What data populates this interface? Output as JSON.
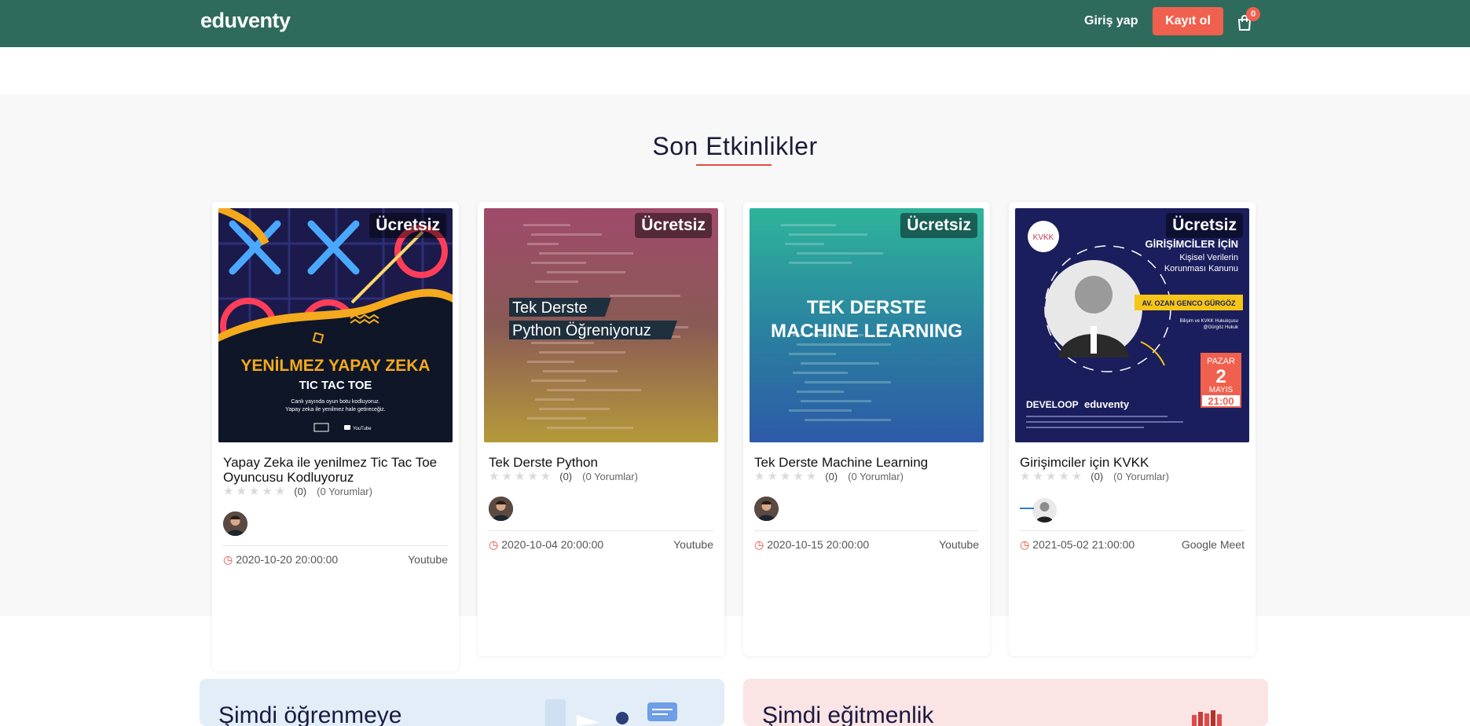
{
  "header": {
    "logo": "eduventy",
    "login_label": "Giriş yap",
    "register_label": "Kayıt ol",
    "cart_count": "0",
    "colors": {
      "bar": "#2f6b5c",
      "accent": "#f0604e"
    }
  },
  "events": {
    "title": "Son Etkinlikler",
    "cards": [
      {
        "badge": "Ücretsiz",
        "title": "Yapay Zeka ile yenilmez Tic Tac Toe Oyuncusu Kodluyoruz",
        "stars": "★★★★★",
        "rating_count": "(0)",
        "reviews": "(0 Yorumlar)",
        "date": "2020-10-20 20:00:00",
        "platform": "Youtube",
        "poster": {
          "headline": "YENİLMEZ YAPAY ZEKA",
          "sub": "TIC TAC TOE",
          "line1": "Canlı yayında oyun botu kodluyoruz.",
          "line2": "Yapay zeka ile yenilmez hale getireceğiz.",
          "yt": "YouTube"
        }
      },
      {
        "badge": "Ücretsiz",
        "title": "Tek Derste Python",
        "stars": "★★★★★",
        "rating_count": "(0)",
        "reviews": "(0 Yorumlar)",
        "date": "2020-10-04 20:00:00",
        "platform": "Youtube",
        "poster": {
          "line1": "Tek Derste",
          "line2": "Python Öğreniyoruz"
        }
      },
      {
        "badge": "Ücretsiz",
        "title": "Tek Derste Machine Learning",
        "stars": "★★★★★",
        "rating_count": "(0)",
        "reviews": "(0 Yorumlar)",
        "date": "2020-10-15 20:00:00",
        "platform": "Youtube",
        "poster": {
          "line1": "TEK DERSTE",
          "line2": "MACHINE LEARNING"
        }
      },
      {
        "badge": "Ücretsiz",
        "title": "Girişimciler için KVKK",
        "stars": "★★★★★",
        "rating_count": "(0)",
        "reviews": "(0 Yorumlar)",
        "date": "2021-05-02 21:00:00",
        "platform": "Google Meet",
        "poster": {
          "kvkk": "KVKK",
          "head": "GİRİŞİMCİLER İÇİN",
          "sub1": "Kişisel Verilerin",
          "sub2": "Korunması Kanunu",
          "speaker": "AV. OZAN GENCO GÜRGÖZ",
          "role1": "Bilişim ve KVKK Hukukçusu",
          "role2": "@Gürgöz Hukuk",
          "day": "PAZAR",
          "date_num": "2",
          "month": "MAYIS",
          "time": "21:00",
          "brand1": "DEVELOOP",
          "brand2": "eduventy"
        }
      }
    ]
  },
  "cta": {
    "learn_title": "Şimdi öğrenmeye",
    "teach_title": "Şimdi eğitmenlik"
  }
}
